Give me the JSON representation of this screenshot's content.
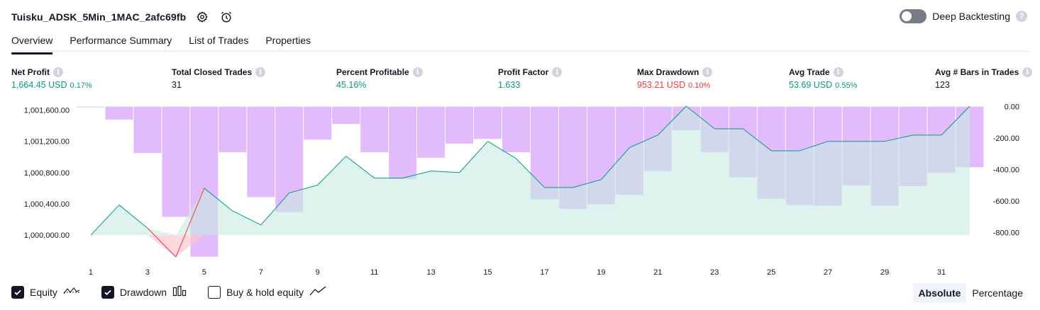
{
  "header": {
    "strategy_name": "Tuisku_ADSK_5Min_1MAC_2afc69fb",
    "deep_backtesting_label": "Deep Backtesting",
    "deep_backtesting_enabled": false
  },
  "tabs": [
    {
      "label": "Overview",
      "active": true
    },
    {
      "label": "Performance Summary",
      "active": false
    },
    {
      "label": "List of Trades",
      "active": false
    },
    {
      "label": "Properties",
      "active": false
    }
  ],
  "metrics": {
    "net_profit": {
      "label": "Net Profit",
      "value": "1,664.45 USD",
      "pct": "0.17%"
    },
    "total_closed_trades": {
      "label": "Total Closed Trades",
      "value": "31"
    },
    "percent_profitable": {
      "label": "Percent Profitable",
      "value": "45.16%"
    },
    "profit_factor": {
      "label": "Profit Factor",
      "value": "1.633"
    },
    "max_drawdown": {
      "label": "Max Drawdown",
      "value": "953.21 USD",
      "pct": "0.10%"
    },
    "avg_trade": {
      "label": "Avg Trade",
      "value": "53.69 USD",
      "pct": "0.55%"
    },
    "avg_bars_in_trades": {
      "label": "Avg # Bars in Trades",
      "value": "123"
    }
  },
  "chart_data": {
    "type": "line",
    "x_ticks": [
      1,
      3,
      5,
      7,
      9,
      11,
      13,
      15,
      17,
      19,
      21,
      23,
      25,
      27,
      29,
      31
    ],
    "y_left_ticks": [
      "1,001,600.00",
      "1,001,200.00",
      "1,000,800.00",
      "1,000,400.00",
      "1,000,000.00"
    ],
    "y_right_ticks": [
      "0.00",
      "-200.00",
      "-400.00",
      "-600.00",
      "-800.00"
    ],
    "y_left_range": [
      999730,
      1001650
    ],
    "y_right_range": [
      -950,
      3
    ],
    "colors": {
      "equity_line": "#089981",
      "equity_fill": "#c8ebe3",
      "negative_line": "#f23645",
      "drawdown_bar": "#e1bbfb"
    },
    "series": [
      {
        "name": "Equity",
        "x": [
          1,
          2,
          3,
          4,
          5,
          6,
          7,
          8,
          9,
          10,
          11,
          12,
          13,
          14,
          15,
          16,
          17,
          18,
          19,
          20,
          21,
          22,
          23,
          24,
          25,
          26,
          27,
          28,
          29,
          30,
          31,
          32
        ],
        "values": [
          1000000,
          1000385,
          1000090,
          999720,
          1000600,
          1000310,
          1000130,
          1000540,
          1000640,
          1001010,
          1000730,
          1000730,
          1000820,
          1000800,
          1001200,
          1000980,
          1000610,
          1000610,
          1000710,
          1001120,
          1001280,
          1001650,
          1001360,
          1001360,
          1001080,
          1001080,
          1001200,
          1001200,
          1001200,
          1001280,
          1001280,
          1001650
        ]
      },
      {
        "name": "Drawdown",
        "x": [
          1,
          2,
          3,
          4,
          5,
          6,
          7,
          8,
          9,
          10,
          11,
          12,
          13,
          14,
          15,
          16,
          17,
          18,
          19,
          20,
          21,
          22,
          23,
          24,
          25,
          26,
          27,
          28,
          29,
          30,
          31,
          32
        ],
        "values": [
          0,
          -82,
          -295,
          -700,
          -953,
          -290,
          -575,
          -670,
          -210,
          -110,
          -290,
          -460,
          -325,
          -235,
          -205,
          -290,
          -590,
          -650,
          -620,
          -560,
          -410,
          -150,
          -290,
          -450,
          -585,
          -625,
          -630,
          -500,
          -630,
          -505,
          -420,
          -385
        ]
      }
    ]
  },
  "legend": {
    "equity": {
      "label": "Equity",
      "checked": true
    },
    "drawdown": {
      "label": "Drawdown",
      "checked": true
    },
    "buy_hold": {
      "label": "Buy & hold equity",
      "checked": false
    }
  },
  "mode": {
    "absolute_label": "Absolute",
    "percentage_label": "Percentage",
    "selected": "Absolute"
  }
}
